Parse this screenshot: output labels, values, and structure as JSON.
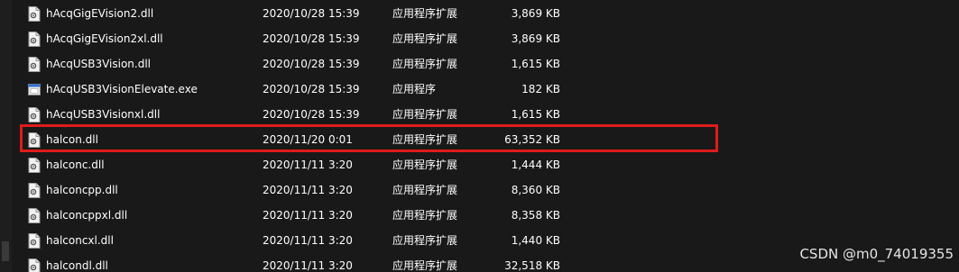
{
  "colors": {
    "background": "#191919",
    "text": "#ffffff",
    "highlight": "#e01b1b"
  },
  "files": [
    {
      "name": "hAcqGigEVision2.dll",
      "date": "2020/10/28 15:39",
      "type": "应用程序扩展",
      "size": "3,869 KB",
      "icon": "dll-file-icon"
    },
    {
      "name": "hAcqGigEVision2xl.dll",
      "date": "2020/10/28 15:39",
      "type": "应用程序扩展",
      "size": "3,869 KB",
      "icon": "dll-file-icon"
    },
    {
      "name": "hAcqUSB3Vision.dll",
      "date": "2020/10/28 15:39",
      "type": "应用程序扩展",
      "size": "1,615 KB",
      "icon": "dll-file-icon"
    },
    {
      "name": "hAcqUSB3VisionElevate.exe",
      "date": "2020/10/28 15:39",
      "type": "应用程序",
      "size": "182 KB",
      "icon": "exe-file-icon"
    },
    {
      "name": "hAcqUSB3Visionxl.dll",
      "date": "2020/10/28 15:39",
      "type": "应用程序扩展",
      "size": "1,615 KB",
      "icon": "dll-file-icon"
    },
    {
      "name": "halcon.dll",
      "date": "2020/11/20 0:01",
      "type": "应用程序扩展",
      "size": "63,352 KB",
      "icon": "dll-file-icon"
    },
    {
      "name": "halconc.dll",
      "date": "2020/11/11 3:20",
      "type": "应用程序扩展",
      "size": "1,444 KB",
      "icon": "dll-file-icon"
    },
    {
      "name": "halconcpp.dll",
      "date": "2020/11/11 3:20",
      "type": "应用程序扩展",
      "size": "8,360 KB",
      "icon": "dll-file-icon"
    },
    {
      "name": "halconcppxl.dll",
      "date": "2020/11/11 3:20",
      "type": "应用程序扩展",
      "size": "8,358 KB",
      "icon": "dll-file-icon"
    },
    {
      "name": "halconcxl.dll",
      "date": "2020/11/11 3:20",
      "type": "应用程序扩展",
      "size": "1,440 KB",
      "icon": "dll-file-icon"
    },
    {
      "name": "halcondl.dll",
      "date": "2020/11/11 3:20",
      "type": "应用程序扩展",
      "size": "32,518 KB",
      "icon": "dll-file-icon"
    }
  ],
  "watermark": "CSDN @m0_74019355"
}
